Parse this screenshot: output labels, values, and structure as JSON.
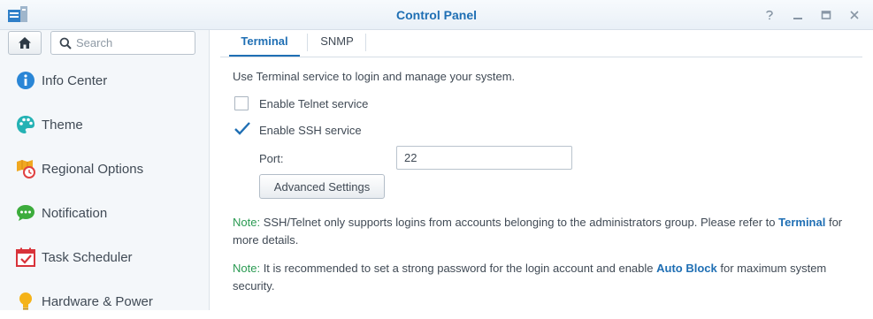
{
  "window": {
    "title": "Control Panel",
    "help_icon": "help-icon",
    "pin_icon": "pin-icon",
    "maximize_icon": "maximize-icon",
    "close_icon": "close-icon"
  },
  "sidebar": {
    "search_placeholder": "Search",
    "items": [
      {
        "label": "Info Center",
        "icon": "info-icon"
      },
      {
        "label": "Theme",
        "icon": "palette-icon"
      },
      {
        "label": "Regional Options",
        "icon": "regional-options-icon"
      },
      {
        "label": "Notification",
        "icon": "chat-bubble-icon"
      },
      {
        "label": "Task Scheduler",
        "icon": "calendar-check-icon"
      },
      {
        "label": "Hardware & Power",
        "icon": "lightbulb-icon"
      }
    ]
  },
  "tabs": [
    {
      "label": "Terminal",
      "active": true
    },
    {
      "label": "SNMP",
      "active": false
    }
  ],
  "terminal": {
    "description": "Use Terminal service to login and manage your system.",
    "telnet": {
      "label": "Enable Telnet service",
      "checked": false
    },
    "ssh": {
      "label": "Enable SSH service",
      "checked": true
    },
    "port_label": "Port:",
    "port_value": "22",
    "advanced_button": "Advanced Settings",
    "note1": {
      "label": "Note:",
      "text_before": " SSH/Telnet only supports logins from accounts belonging to the administrators group. Please refer to ",
      "link": "Terminal",
      "text_after": " for more details."
    },
    "note2": {
      "label": "Note:",
      "text_before": " It is recommended to set a strong password for the login account and enable ",
      "link": "Auto Block",
      "text_after": " for maximum system security."
    }
  },
  "colors": {
    "accent": "#1f6fb4",
    "note_green": "#2a9a52",
    "checkmark": "#1f6fb4"
  }
}
